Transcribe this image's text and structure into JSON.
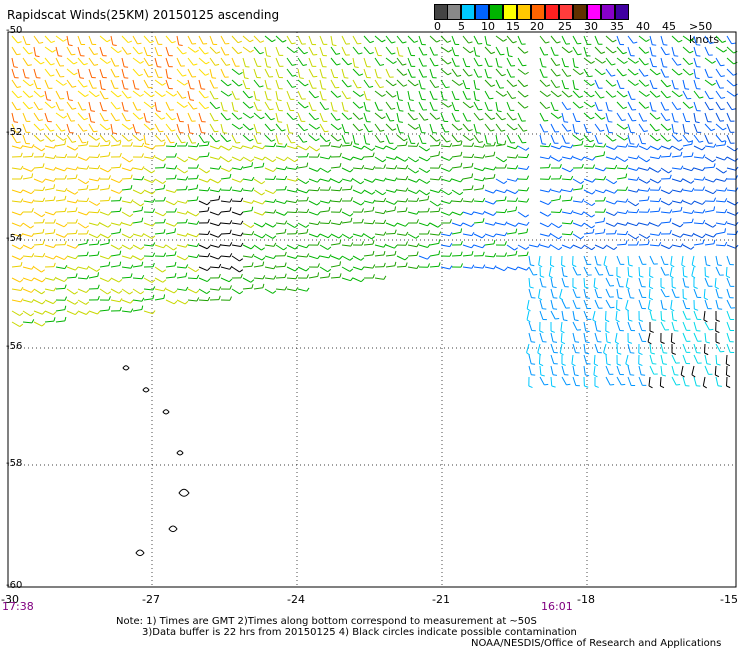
{
  "title": "Rapidscat Winds(25KM) 20150125 ascending",
  "legend": {
    "colors": [
      "#444444",
      "#888888",
      "#00c8ff",
      "#0064ff",
      "#00b400",
      "#ffff00",
      "#ffc800",
      "#ff6400",
      "#ff2020",
      "#ff3c3c",
      "#603000",
      "#ff00ff",
      "#8800c8",
      "#4000a0"
    ],
    "ticks": [
      "0",
      "5",
      "10",
      "15",
      "20",
      "25",
      "30",
      "35",
      "40",
      "45",
      ">50 knots"
    ]
  },
  "map": {
    "lat_labels": [
      "-50",
      "-52",
      "-54",
      "-56",
      "-58",
      "-60"
    ],
    "lon_labels": [
      "-27",
      "-24",
      "-21",
      "-18",
      "-15"
    ],
    "edge_label": "-30",
    "time_left": "17:38",
    "time_right": "16:01"
  },
  "notes": {
    "line1": "Note: 1) Times are GMT 2)Times along bottom correspond to measurement at ~50S",
    "line2": "3)Data buffer is 22 hrs from 20150125 4) Black circles indicate possible contamination",
    "line3": "NOAA/NESDIS/Office of Research and Applications"
  }
}
